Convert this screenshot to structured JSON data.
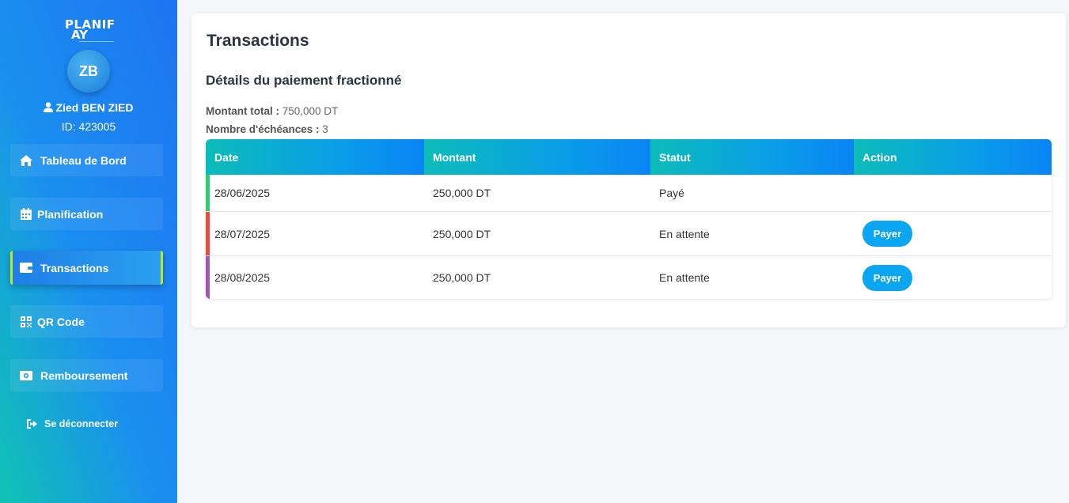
{
  "sidebar": {
    "logo": {
      "line1": "LANIF",
      "line2": "AY",
      "letter": "P"
    },
    "avatar_initials": "ZB",
    "user_name": "Zied BEN ZIED",
    "user_id": "ID: 423005",
    "items": [
      {
        "label": "Tableau de Bord",
        "icon": "home-icon"
      },
      {
        "label": "Planification",
        "icon": "calendar-icon"
      },
      {
        "label": "Transactions",
        "icon": "wallet-icon",
        "active": true
      },
      {
        "label": "QR Code",
        "icon": "qrcode-icon"
      },
      {
        "label": "Remboursement",
        "icon": "money-icon"
      }
    ],
    "logout_label": "Se déconnecter"
  },
  "main": {
    "title": "Transactions",
    "section_title": "Détails du paiement fractionné",
    "total_label": "Montant total :",
    "total_value": "750,000 DT",
    "count_label": "Nombre d'échéances :",
    "count_value": "3",
    "table": {
      "headers": [
        "Date",
        "Montant",
        "Statut",
        "Action"
      ],
      "rows": [
        {
          "date": "28/06/2025",
          "amount": "250,000 DT",
          "status": "Payé",
          "action": "",
          "accent": "#2ecc71"
        },
        {
          "date": "28/07/2025",
          "amount": "250,000 DT",
          "status": "En attente",
          "action": "Payer",
          "accent": "#e74c3c"
        },
        {
          "date": "28/08/2025",
          "amount": "250,000 DT",
          "status": "En attente",
          "action": "Payer",
          "accent": "#9b59b6"
        }
      ]
    }
  },
  "colors": {
    "accent_active": "#b8ea2a",
    "button": "#0aa6f2"
  }
}
